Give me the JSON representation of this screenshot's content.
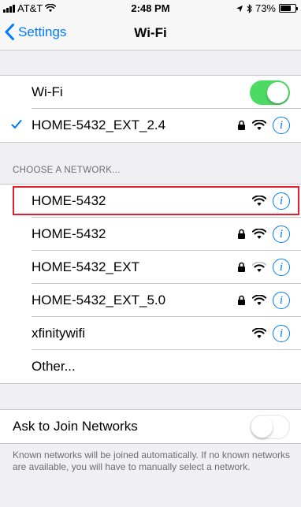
{
  "status_bar": {
    "carrier": "AT&T",
    "time": "2:48 PM",
    "battery_percent": "73%",
    "battery_level": 0.73
  },
  "nav": {
    "back_label": "Settings",
    "title": "Wi-Fi"
  },
  "wifi": {
    "label": "Wi-Fi",
    "enabled": true,
    "connected_network": "HOME-5432_EXT_2.4"
  },
  "networks_header": "CHOOSE A NETWORK...",
  "networks": [
    {
      "name": "HOME-5432",
      "locked": false,
      "signal": "full"
    },
    {
      "name": "HOME-5432",
      "locked": true,
      "signal": "full"
    },
    {
      "name": "HOME-5432_EXT",
      "locked": true,
      "signal": "medium"
    },
    {
      "name": "HOME-5432_EXT_5.0",
      "locked": true,
      "signal": "full"
    },
    {
      "name": "xfinitywifi",
      "locked": false,
      "signal": "full"
    }
  ],
  "other_label": "Other...",
  "ask_to_join": {
    "label": "Ask to Join Networks",
    "enabled": false
  },
  "footer_text": "Known networks will be joined automatically. If no known networks are available, you will have to manually select a network.",
  "colors": {
    "accent": "#007aff",
    "toggle_on": "#4cd964",
    "highlight": "#e02030"
  }
}
